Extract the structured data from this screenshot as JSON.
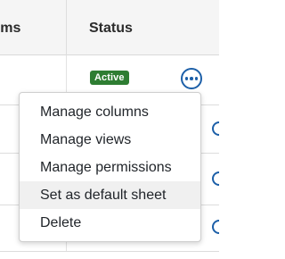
{
  "table": {
    "columns": [
      "rms",
      "Status"
    ],
    "rows": [
      {
        "status": "Active"
      },
      {
        "status": ""
      },
      {
        "status": ""
      },
      {
        "status": ""
      }
    ]
  },
  "row_actions": {
    "icon": "more-horizontal-icon"
  },
  "menu": {
    "items": [
      {
        "label": "Manage columns",
        "highlighted": false
      },
      {
        "label": "Manage views",
        "highlighted": false
      },
      {
        "label": "Manage permissions",
        "highlighted": false
      },
      {
        "label": "Set as default sheet",
        "highlighted": true
      },
      {
        "label": "Delete",
        "highlighted": false
      }
    ]
  },
  "colors": {
    "header_bg": "#f5f5f5",
    "badge_active": "#2e7d32",
    "accent": "#1c5fa8",
    "menu_highlight": "#f0f0f0"
  }
}
